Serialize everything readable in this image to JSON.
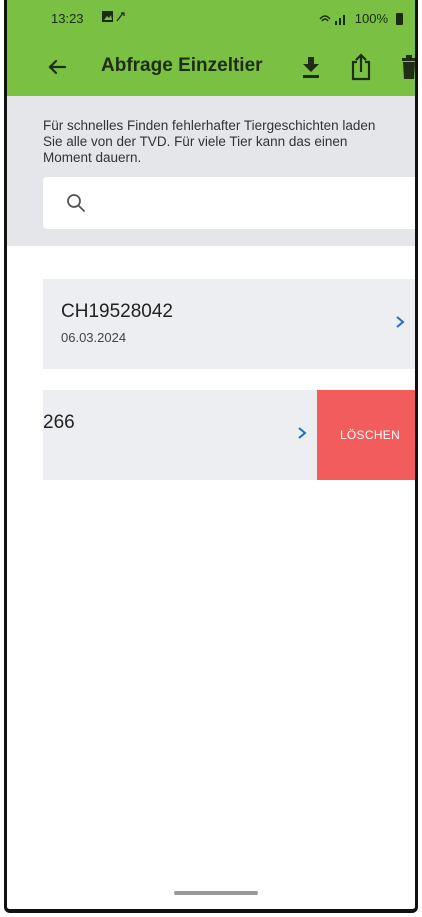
{
  "status_bar": {
    "time": "13:23",
    "battery": "100%"
  },
  "app_bar": {
    "title": "Abfrage Einzeltier"
  },
  "info": {
    "text": "Für schnelles Finden fehlerhafter Tiergeschichten laden Sie alle von der TVD. Für viele Tier kann das einen Moment dauern."
  },
  "search": {
    "placeholder": ""
  },
  "list": [
    {
      "id": "CH19528042",
      "date": "06.03.2024"
    },
    {
      "id": "266",
      "date": ""
    }
  ],
  "swipe_action": {
    "label": "LÖSCHEN"
  },
  "colors": {
    "accent": "#7ac143",
    "delete": "#f25c5c",
    "chevron": "#1f6fbf"
  }
}
